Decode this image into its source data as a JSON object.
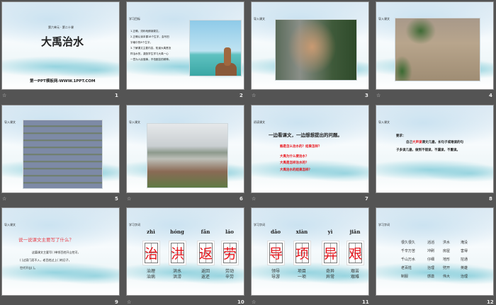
{
  "slides": [
    {
      "number": "1",
      "subtitle": "第六单元 · 第二十课",
      "title": "大禹治水",
      "footer": "第一PPT模板网-WWW.1PPT.COM"
    },
    {
      "number": "2",
      "label": "学习目标",
      "lines": [
        "1.正确、流利地朗读课文。",
        "2.正确认读本课18个生字，会写田",
        "字格中的8个生字。",
        "3.了解课文主要内容，知道大禹是怎",
        "样治水的，激励学生学习大禹一心",
        "一意为人民做事，不怕困苦的精神。"
      ]
    },
    {
      "number": "3",
      "label": "导入课文"
    },
    {
      "number": "4",
      "label": "导入课文"
    },
    {
      "number": "5",
      "label": "导入课文"
    },
    {
      "number": "6",
      "label": "导入课文"
    },
    {
      "number": "7",
      "label": "初读课文",
      "heading": "一边看课文，一边想想提出的问题。",
      "questions": [
        "鲧是怎么治水的？结果怎样？",
        "大禹为什么要治水？",
        "大禹是怎样治水的？",
        "大禹治水的结果怎样？"
      ]
    },
    {
      "number": "8",
      "label": "导入课文",
      "req": "要求：",
      "line1a": "自己",
      "line1b": "大声读",
      "line1c": "课文几遍，长句子或难读的句",
      "line2": "子多读几遍，做到不错读，不漏读，不重读。"
    },
    {
      "number": "9",
      "label": "导入课文",
      "heading": "说一说课文主要写了什么？",
      "lines": [
        "这篇课文主要写(       )带领百姓开山挖河，",
        "(      )过家门而不入，老百姓过上(      )的日子，",
        "世代不忘(   )。"
      ]
    },
    {
      "number": "10",
      "label": "学习字词",
      "chars": [
        {
          "py": "zhì",
          "ch": "治",
          "w1": "治理",
          "w2": "治病"
        },
        {
          "py": "hóng",
          "ch": "洪",
          "w1": "洪水",
          "w2": "洪涝"
        },
        {
          "py": "fǎn",
          "ch": "返",
          "w1": "返回",
          "w2": "返还"
        },
        {
          "py": "láo",
          "ch": "劳",
          "w1": "劳动",
          "w2": "辛劳"
        }
      ]
    },
    {
      "number": "11",
      "label": "学习字词",
      "chars": [
        {
          "py": "dǎo",
          "ch": "导",
          "w1": "领导",
          "w2": "导游"
        },
        {
          "py": "xiàn",
          "ch": "项",
          "w1": "项目",
          "w2": "一项"
        },
        {
          "py": "yì",
          "ch": "异",
          "w1": "奇异",
          "w2": "异常"
        },
        {
          "py": "jiān",
          "ch": "艰",
          "w1": "艰苦",
          "w2": "艰难"
        }
      ]
    },
    {
      "number": "12",
      "label": "学习字词",
      "words": [
        [
          "很久很久",
          "滔滔",
          "洪水",
          "淹没"
        ],
        [
          "千辛万苦",
          "冲刷",
          "房屋",
          "害得"
        ],
        [
          "千山万水",
          "仔细",
          "地形",
          "挖通"
        ],
        [
          "老百姓",
          "治理",
          "劈开",
          "英雄"
        ],
        [
          "制服",
          "感激",
          "伟大",
          "治理"
        ]
      ]
    }
  ],
  "animation_icon": "animation-star-icon",
  "colors": {
    "accent_red": "#e8141b",
    "background": "#545454"
  }
}
